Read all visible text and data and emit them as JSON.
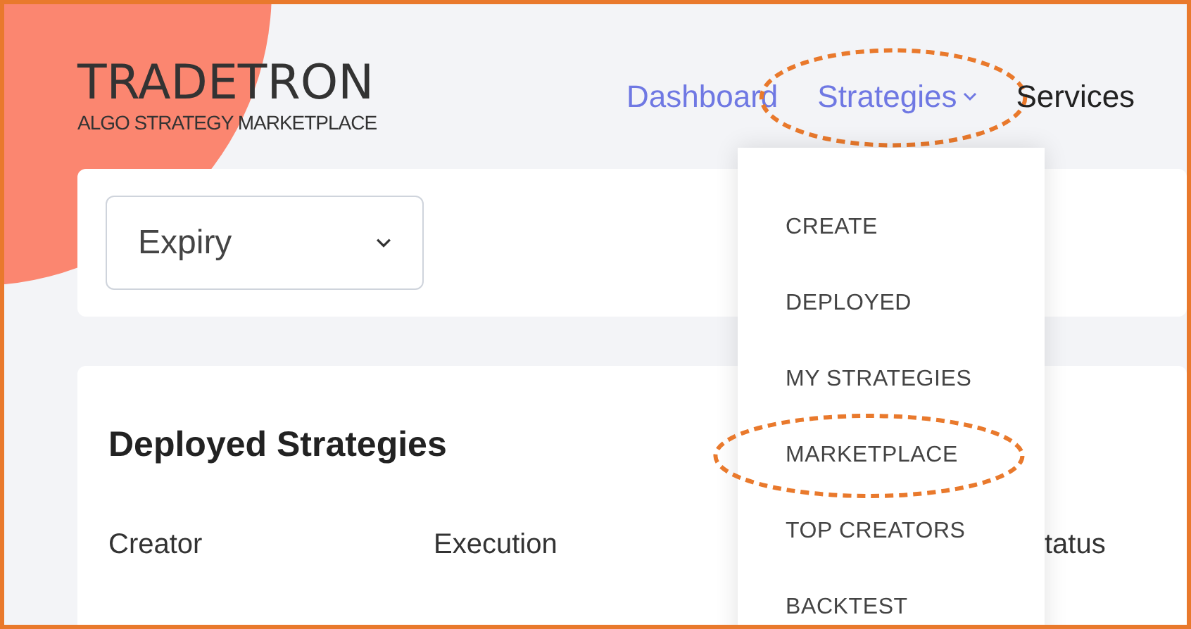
{
  "logo": {
    "name": "TRADETRON",
    "tagline": "ALGO STRATEGY MARKETPLACE"
  },
  "nav": [
    {
      "label": "Dashboard",
      "kind": "link",
      "highlighted": false
    },
    {
      "label": "Strategies",
      "kind": "dropdown",
      "highlighted": true
    },
    {
      "label": "Services",
      "kind": "plain",
      "highlighted": false
    }
  ],
  "menu": [
    {
      "label": "CREATE",
      "highlighted": false
    },
    {
      "label": "DEPLOYED",
      "highlighted": false
    },
    {
      "label": "MY STRATEGIES",
      "highlighted": false
    },
    {
      "label": "MARKETPLACE",
      "highlighted": true
    },
    {
      "label": "TOP CREATORS",
      "highlighted": false
    },
    {
      "label": "BACKTEST",
      "highlighted": false
    }
  ],
  "filter": {
    "value": "Expiry"
  },
  "deployed": {
    "title": "Deployed Strategies",
    "columns": [
      "Creator",
      "Execution",
      "tatus"
    ]
  }
}
